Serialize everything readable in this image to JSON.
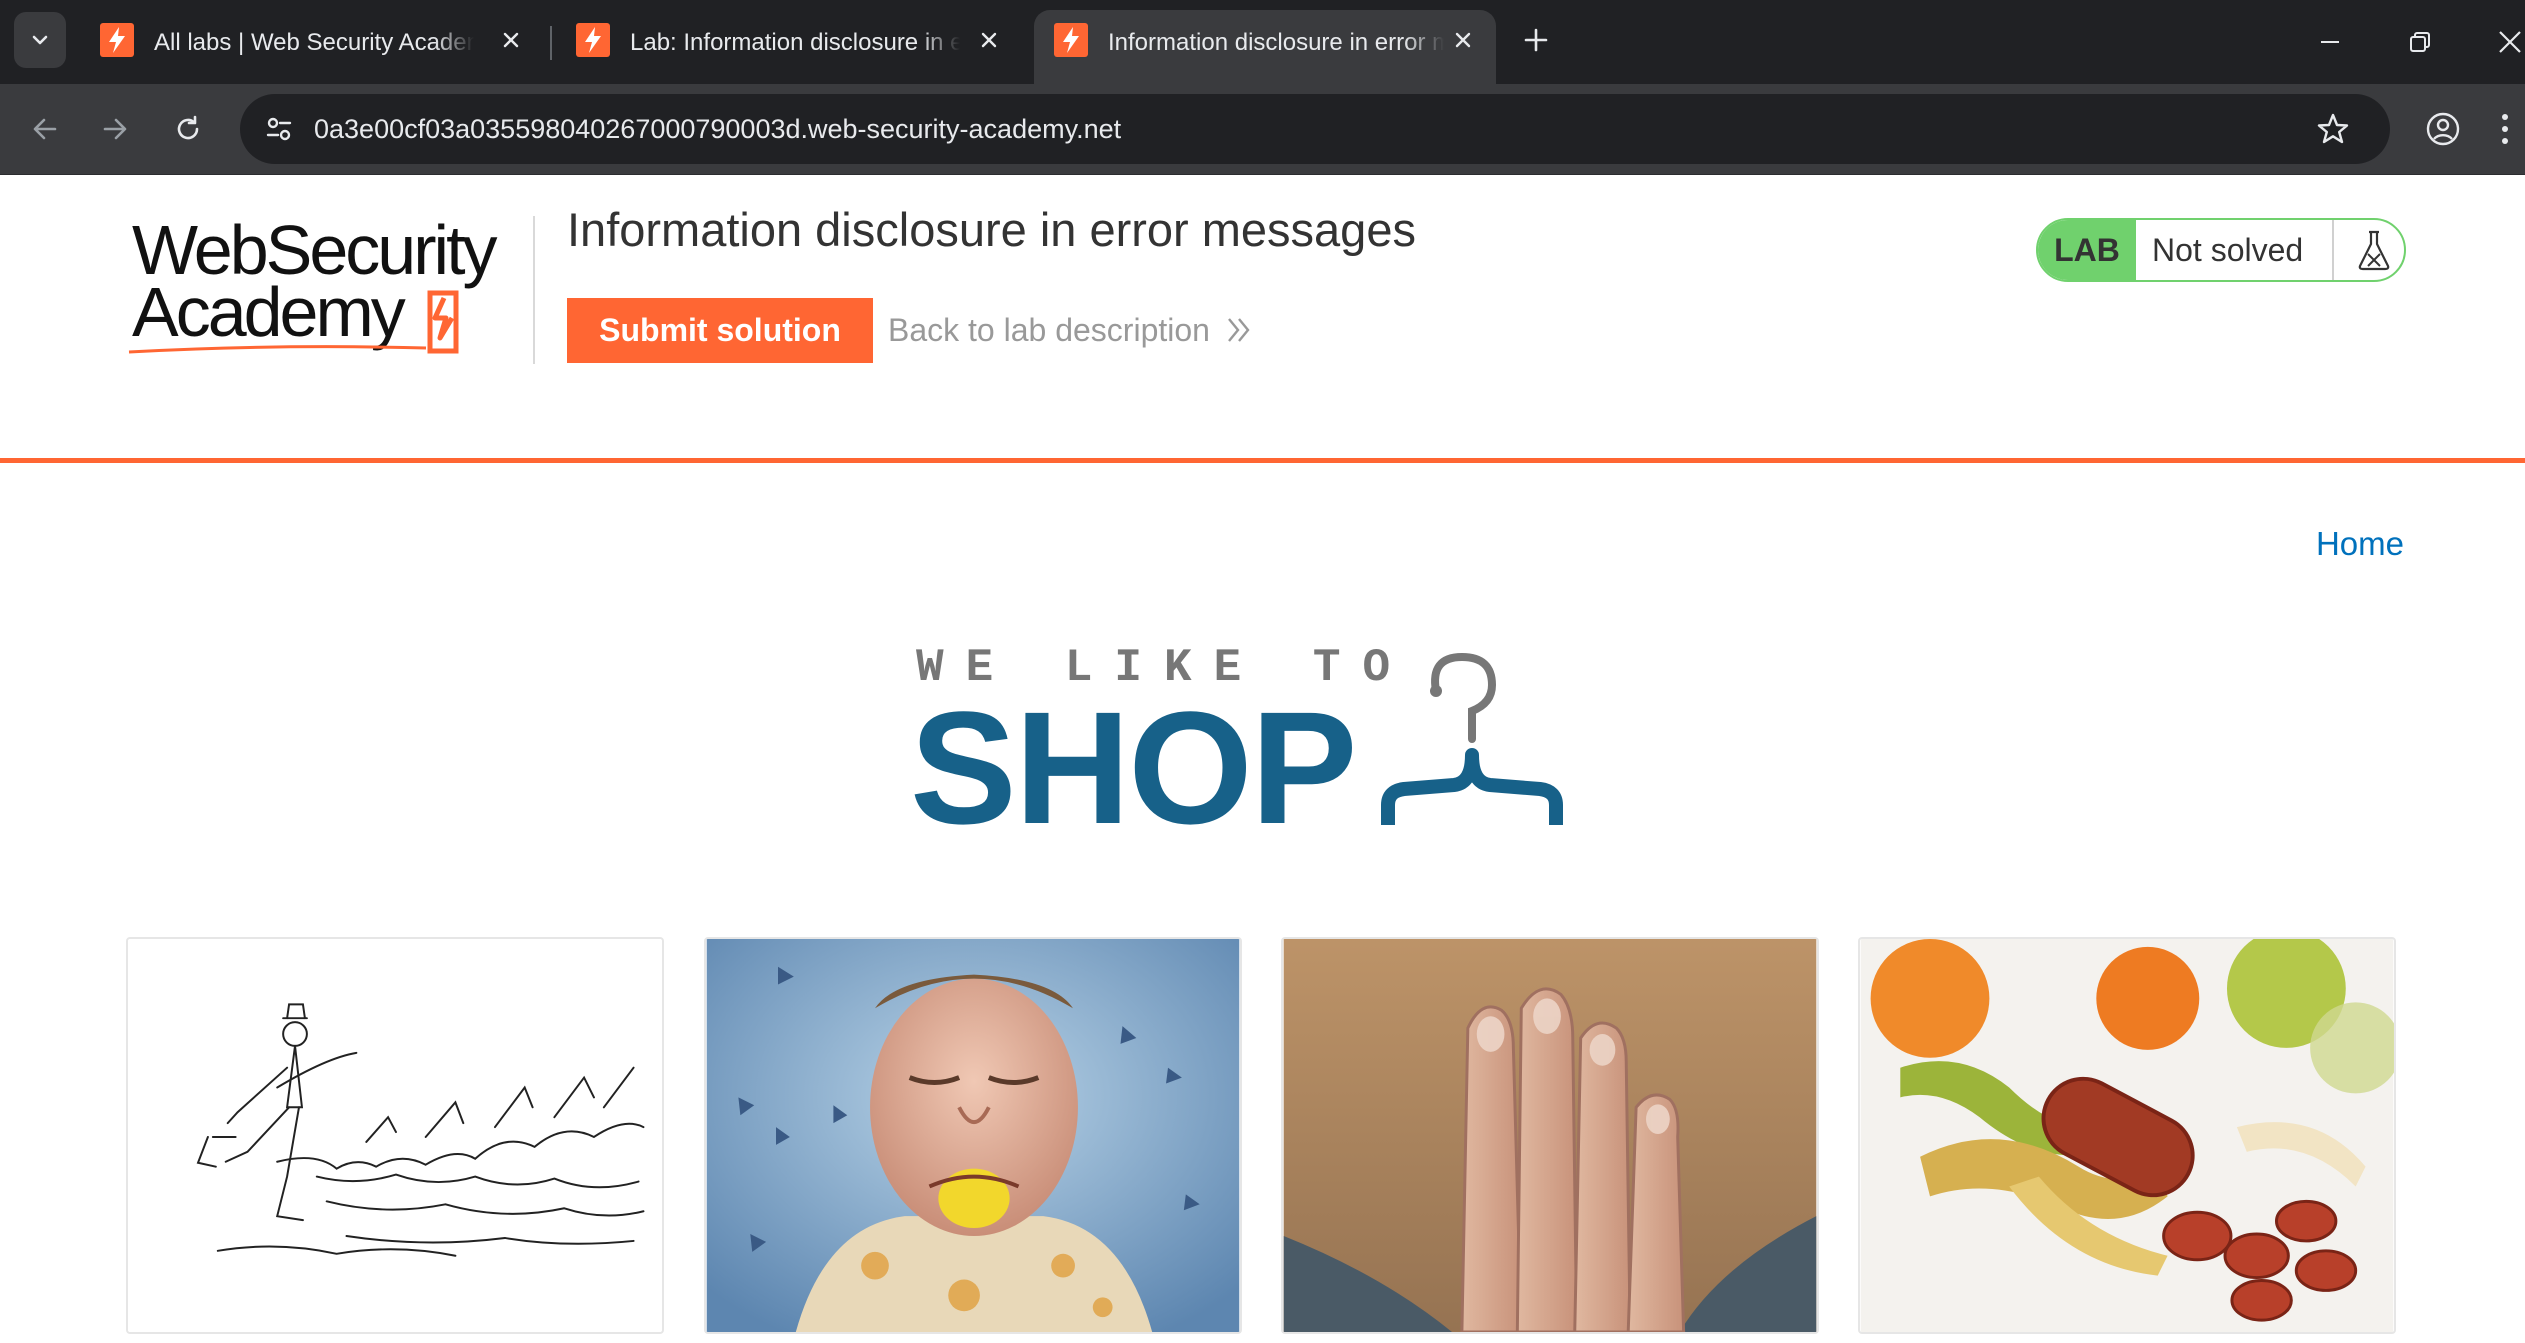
{
  "browser": {
    "tabs": [
      {
        "title": "All labs | Web Security Academy",
        "active": false
      },
      {
        "title": "Lab: Information disclosure in error messages",
        "active": false
      },
      {
        "title": "Information disclosure in error messages",
        "active": true
      }
    ],
    "address_bar": {
      "url": "0a3e00cf03a035598040267000790003d.web-security-academy.net"
    },
    "icons": {
      "tab_menu": "chevron-down-icon",
      "favicon": "lightning-bolt-icon",
      "close_tab": "close-icon",
      "new_tab": "plus-icon",
      "minimize": "minimize-icon",
      "restore": "restore-icon",
      "close_window": "close-icon",
      "back": "arrow-left-icon",
      "forward": "arrow-right-icon",
      "reload": "reload-icon",
      "site_info": "tune-icon",
      "bookmark": "star-icon",
      "profile": "account-icon",
      "menu": "kebab-menu-icon"
    }
  },
  "header": {
    "logo_line1": "WebSecurity",
    "logo_line2": "Academy",
    "lab_title": "Information disclosure in error messages",
    "submit_label": "Submit solution",
    "back_label": "Back to lab description",
    "lab_badge": "LAB",
    "lab_status": "Not solved",
    "colors": {
      "accent": "#ff6633",
      "solved_green": "#70d16d",
      "link_blue": "#0071bc"
    }
  },
  "nav": {
    "home_label": "Home"
  },
  "shop_logo": {
    "tagline": "WE LIKE TO",
    "word": "SHOP",
    "color": "#176189"
  },
  "products": [
    {
      "image": "sketch-man-cats-image"
    },
    {
      "image": "man-lemon-face-image"
    },
    {
      "image": "hand-over-beard-image"
    },
    {
      "image": "banana-sausage-image"
    }
  ]
}
